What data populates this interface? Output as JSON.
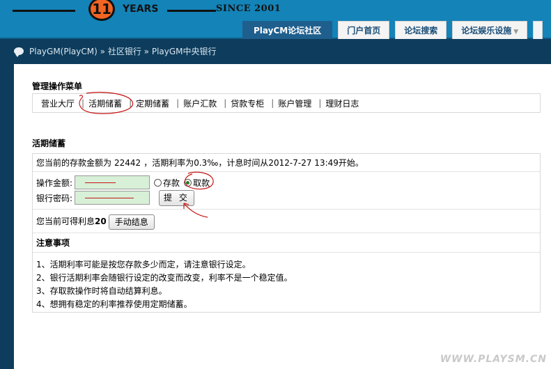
{
  "logo": {
    "number": "11",
    "years": "YEARS",
    "since": "SINCE 2001"
  },
  "nav": {
    "tabs": [
      {
        "label": "PlayCM论坛社区",
        "active": true
      },
      {
        "label": "门户首页"
      },
      {
        "label": "论坛搜索"
      },
      {
        "label": "论坛娱乐设施",
        "has_dropdown": true
      }
    ]
  },
  "breadcrumb": {
    "items": [
      "PlayGM(PlayCM)",
      "社区银行",
      "PlayGM中央银行"
    ],
    "separator": "»"
  },
  "menu": {
    "title": "管理操作菜单",
    "items": [
      "营业大厅",
      "活期储蓄",
      "定期储蓄",
      "账户汇款",
      "贷款专柜",
      "账户管理",
      "理财日志"
    ],
    "separator": "|"
  },
  "current_deposit": {
    "title": "活期储蓄",
    "balance_prefix": "您当前的存款金额为",
    "balance": "22442",
    "balance_suffix": "，活期利率为0.3‰，计息时间从2012-7-27 13:49开始。",
    "amount_label": "操作金额:",
    "password_label": "银行密码:",
    "option_deposit": "存款",
    "option_withdraw": "取款",
    "submit_label": "提 交",
    "interest_text": "您当前可得利息",
    "interest_value": "20",
    "settle_label": "手动结息"
  },
  "notice": {
    "title": "注意事项",
    "lines": [
      "1、活期利率可能是按您存款多少而定，请注意银行设定。",
      "2、银行活期利率会随银行设定的改变而改变，利率不是一个稳定值。",
      "3、存取款操作时将自动结算利息。",
      "4、想拥有稳定的利率推荐使用定期储蓄。"
    ]
  },
  "watermark": "WWW.PLAYSM.CN",
  "colors": {
    "header_bg": "#1383b8",
    "page_bg": "#0d3c5c",
    "active_tab": "#1e5f8e",
    "input_bg": "#d7f0d7",
    "annotation": "#c81414"
  }
}
